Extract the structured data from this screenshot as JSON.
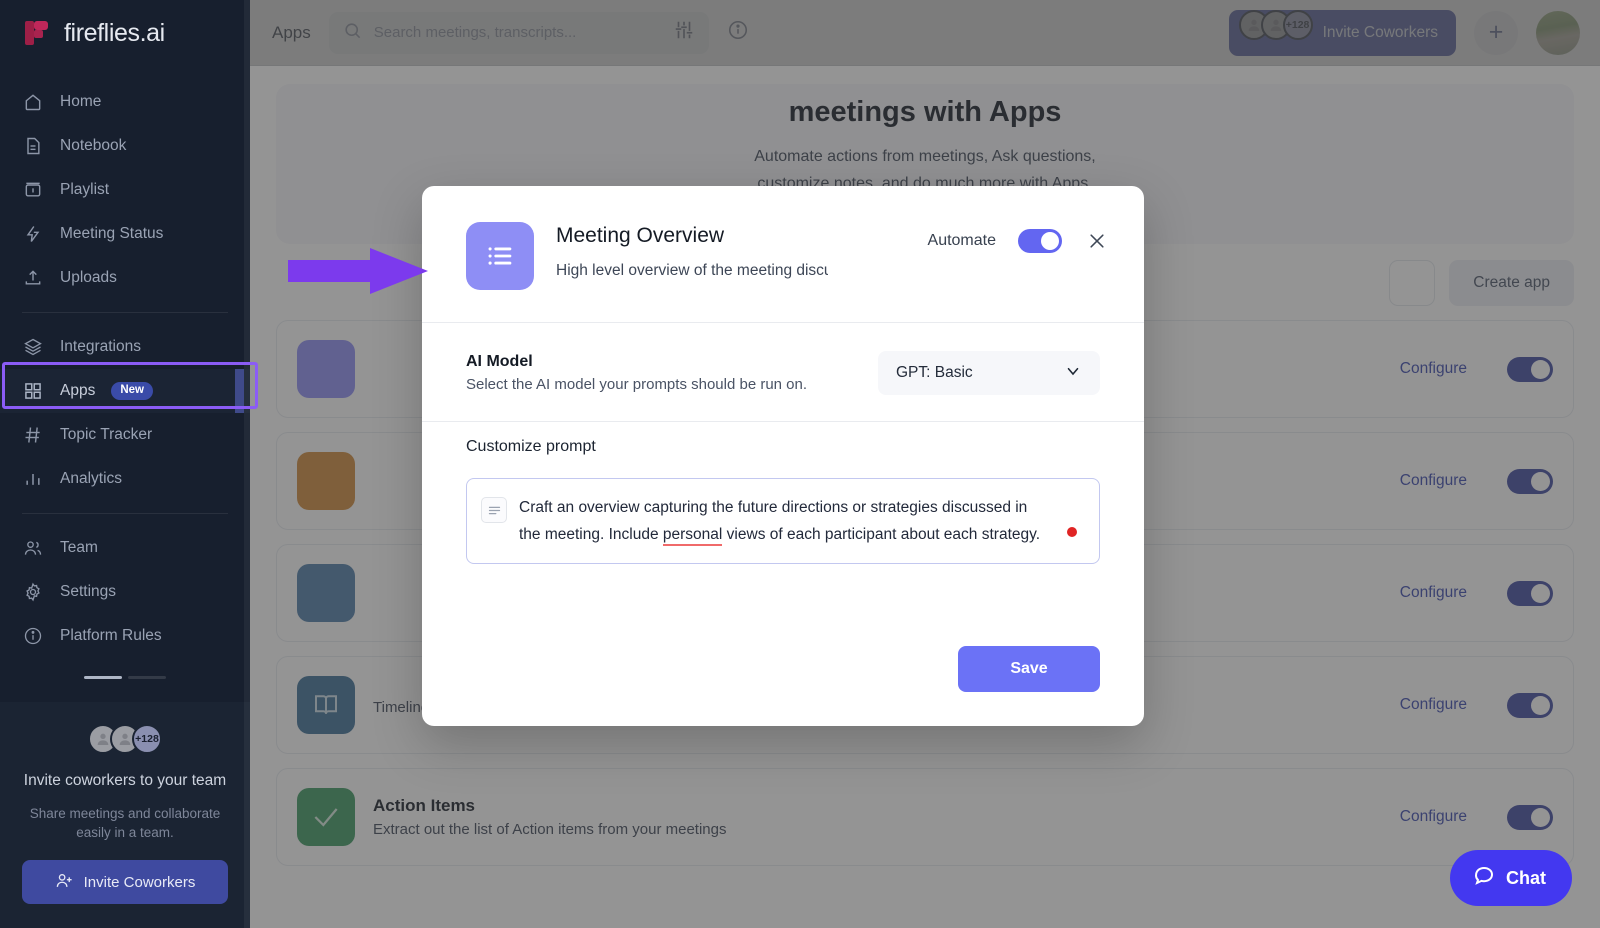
{
  "brand": {
    "name": "fireflies.ai",
    "logo_icon": "fireflies-logo-icon"
  },
  "sidebar": {
    "items": [
      {
        "label": "Home",
        "icon": "home-icon"
      },
      {
        "label": "Notebook",
        "icon": "notebook-icon"
      },
      {
        "label": "Playlist",
        "icon": "playlist-icon"
      },
      {
        "label": "Meeting Status",
        "icon": "lightning-icon"
      },
      {
        "label": "Uploads",
        "icon": "upload-icon"
      }
    ],
    "items2": [
      {
        "label": "Integrations",
        "icon": "layers-icon",
        "badge": ""
      },
      {
        "label": "Apps",
        "icon": "grid-icon",
        "badge": "New"
      },
      {
        "label": "Topic Tracker",
        "icon": "hash-icon",
        "badge": ""
      },
      {
        "label": "Analytics",
        "icon": "bar-chart-icon",
        "badge": ""
      }
    ],
    "items3": [
      {
        "label": "Team",
        "icon": "people-icon"
      },
      {
        "label": "Settings",
        "icon": "gear-icon"
      },
      {
        "label": "Platform Rules",
        "icon": "info-circle-icon"
      }
    ],
    "invite_panel": {
      "avatar_count": "+128",
      "title": "Invite coworkers to your team",
      "subtitle": "Share meetings and collaborate easily in a team.",
      "button_label": "Invite Coworkers",
      "button_icon": "user-plus-icon"
    }
  },
  "topbar": {
    "page_tab": "Apps",
    "search_placeholder": "Search meetings, transcripts...",
    "search_value": "",
    "search_icon": "search-icon",
    "filter_icon": "sliders-icon",
    "info_icon": "info-circle-icon",
    "invite_label": "Invite Coworkers",
    "invite_count": "+128",
    "plus_label": "+",
    "avatar_icon": "user-avatar"
  },
  "hero": {
    "title": "meetings with Apps",
    "line1": "Automate actions from meetings, Ask questions,",
    "line2": "customize notes, and do much more with Apps."
  },
  "actions": {
    "create_app": "Create app"
  },
  "app_rows": [
    {
      "title": "",
      "desc": "",
      "configure": "Configure",
      "icon": "",
      "color": "#8e8ef5"
    },
    {
      "title": "",
      "desc": "",
      "configure": "Configure",
      "icon": "",
      "color": "#d08a3a"
    },
    {
      "title": "",
      "desc": "",
      "configure": "Configure",
      "icon": "",
      "color": "#4e7ca8"
    },
    {
      "title": "",
      "desc": "Timeline view of your meeting with reference specific time-stamps",
      "configure": "Configure",
      "icon": "book-icon",
      "color": "#3c6f97"
    },
    {
      "title": "Action Items",
      "desc": "Extract out the list of Action items from your meetings",
      "configure": "Configure",
      "icon": "check-icon",
      "color": "#3c9a62"
    }
  ],
  "modal": {
    "app_icon": "list-bullets-icon",
    "title": "Meeting Overview",
    "description": "High level overview of the meeting discu",
    "automate_label": "Automate",
    "automate_on": true,
    "close_icon": "close-icon",
    "model": {
      "title": "AI Model",
      "subtitle": "Select the AI model your prompts should be run on.",
      "selected": "GPT: Basic",
      "chevron_icon": "chevron-down-icon"
    },
    "prompt": {
      "label": "Customize prompt",
      "icon": "text-lines-icon",
      "text_part1": "Craft an overview capturing the future directions or strategies discussed in the meeting. Include ",
      "misspelled_word": "personal",
      "text_part2": " views of each participant about each strategy."
    },
    "save_label": "Save"
  },
  "chat": {
    "label": "Chat",
    "icon": "chat-bubble-icon"
  },
  "colors": {
    "accent_purple": "#6b72f6",
    "brand_indigo": "#3f4aa0",
    "annotation_purple": "#8b5cf6",
    "sidebar_bg": "#171f2e",
    "error_red": "#e02424"
  }
}
